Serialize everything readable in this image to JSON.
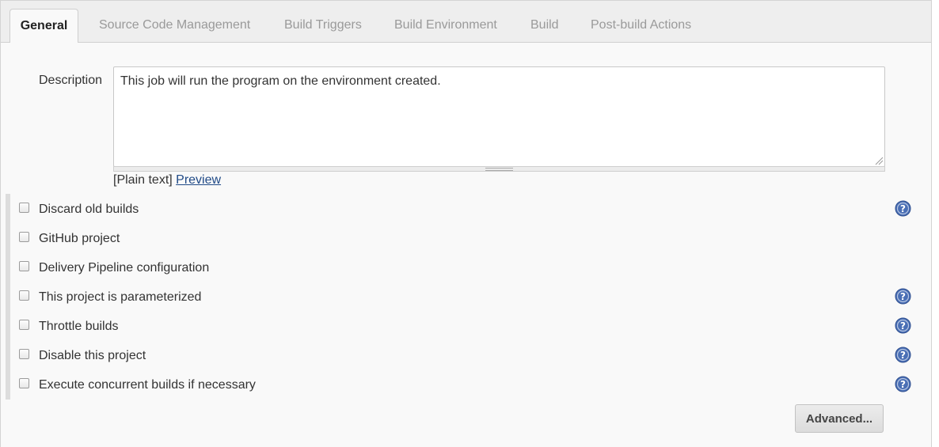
{
  "tabs": [
    {
      "label": "General",
      "active": true
    },
    {
      "label": "Source Code Management"
    },
    {
      "label": "Build Triggers"
    },
    {
      "label": "Build Environment"
    },
    {
      "label": "Build"
    },
    {
      "label": "Post-build Actions"
    }
  ],
  "description": {
    "label": "Description",
    "value": "This job will run the program on the environment created.",
    "format_text": "[Plain text]",
    "preview_link": "Preview"
  },
  "options": [
    {
      "label": "Discard old builds",
      "checked": false,
      "help": true
    },
    {
      "label": "GitHub project",
      "checked": false,
      "help": false
    },
    {
      "label": "Delivery Pipeline configuration",
      "checked": false,
      "help": false
    },
    {
      "label": "This project is parameterized",
      "checked": false,
      "help": true
    },
    {
      "label": "Throttle builds",
      "checked": false,
      "help": true
    },
    {
      "label": "Disable this project",
      "checked": false,
      "help": true
    },
    {
      "label": "Execute concurrent builds if necessary",
      "checked": false,
      "help": true
    }
  ],
  "advanced_button": "Advanced...",
  "icons": {
    "help": "help-question-icon"
  },
  "colors": {
    "link": "#204a87",
    "help_icon": "#4a6fb5",
    "tab_inactive": "#9a9a9a"
  }
}
